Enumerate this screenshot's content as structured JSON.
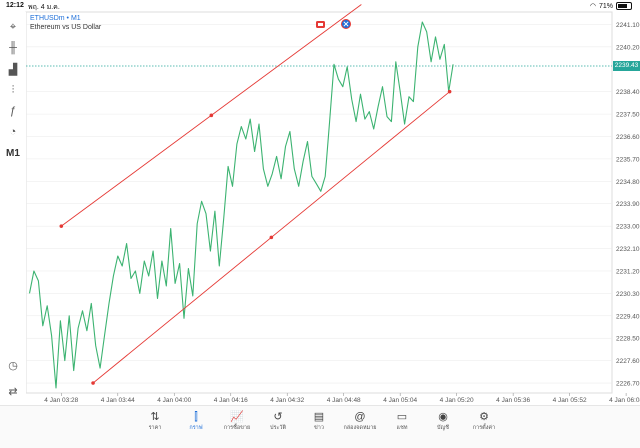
{
  "status": {
    "time": "12:12",
    "date": "พฤ. 4 ม.ค.",
    "battery": "71%",
    "battery_level": 0.71
  },
  "header": {
    "symbol_line": "ETHUSDm • M1",
    "description": "Ethereum vs US Dollar"
  },
  "toolbar": {
    "items": [
      {
        "name": "crosshair-icon",
        "glyph": "⌖"
      },
      {
        "name": "candlestick-icon",
        "glyph": "╫"
      },
      {
        "name": "indicators-icon",
        "glyph": "▟"
      },
      {
        "name": "settings-sliders-icon",
        "glyph": "⫶"
      },
      {
        "name": "function-icon",
        "glyph": "ƒ"
      },
      {
        "name": "shapes-icon",
        "glyph": "◔"
      }
    ],
    "timeframe": "M1",
    "bottom_icons": [
      {
        "name": "speedometer-icon",
        "glyph": "◷"
      },
      {
        "name": "trade-icon",
        "glyph": "⇄"
      }
    ]
  },
  "current_price": "2239.43",
  "chart_data": {
    "type": "line",
    "symbol": "ETHUSDm",
    "timeframe": "M1",
    "x_tick_labels": [
      "4 Jan 03:28",
      "4 Jan 03:44",
      "4 Jan 04:00",
      "4 Jan 04:16",
      "4 Jan 04:32",
      "4 Jan 04:48",
      "4 Jan 05:04",
      "4 Jan 05:20",
      "4 Jan 05:36",
      "4 Jan 05:52",
      "4 Jan 06:08"
    ],
    "y_tick_labels": [
      "2241.10",
      "2240.20",
      "2238.40",
      "2237.50",
      "2236.60",
      "2235.70",
      "2234.80",
      "2233.90",
      "2233.00",
      "2232.10",
      "2231.20",
      "2230.30",
      "2229.40",
      "2228.50",
      "2227.60",
      "2226.70"
    ],
    "ylim": [
      2226.3,
      2241.6
    ],
    "current_price": 2239.43,
    "series": [
      {
        "values": [
          2230.3,
          2231.2,
          2230.8,
          2229.0,
          2229.8,
          2228.6,
          2226.5,
          2229.2,
          2227.6,
          2229.4,
          2227.2,
          2228.9,
          2229.6,
          2228.8,
          2229.9,
          2228.2,
          2227.3,
          2228.6,
          2229.9,
          2231.0,
          2231.8,
          2231.4,
          2232.3,
          2230.9,
          2231.2,
          2230.3,
          2231.6,
          2231.0,
          2232.0,
          2230.1,
          2231.6,
          2230.6,
          2232.9,
          2230.7,
          2231.5,
          2229.3,
          2231.3,
          2230.2,
          2233.1,
          2234.0,
          2233.5,
          2232.0,
          2233.6,
          2231.4,
          2233.3,
          2235.4,
          2234.6,
          2236.3,
          2237.0,
          2236.5,
          2237.3,
          2236.0,
          2237.1,
          2235.3,
          2234.6,
          2235.1,
          2235.8,
          2234.9,
          2236.2,
          2236.8,
          2235.3,
          2234.6,
          2235.6,
          2236.4,
          2235.0,
          2234.7,
          2234.4,
          2235.0,
          2237.2,
          2239.5,
          2238.9,
          2238.6,
          2239.4,
          2238.1,
          2237.2,
          2238.3,
          2237.3,
          2237.6,
          2236.9,
          2237.8,
          2238.6,
          2237.4,
          2237.2,
          2239.6,
          2238.4,
          2237.1,
          2238.2,
          2238.0,
          2240.2,
          2241.2,
          2240.8,
          2239.6,
          2240.6,
          2239.7,
          2240.3,
          2238.4,
          2239.5
        ]
      }
    ],
    "trend_channel": {
      "upper": {
        "from": {
          "x": "4 Jan 03:28",
          "y": 2233.0
        },
        "to": {
          "x": "4 Jan 04:53",
          "y": 2241.9
        }
      },
      "lower": {
        "from": {
          "x": "4 Jan 03:37",
          "y": 2226.7
        },
        "to": {
          "x": "4 Jan 05:18",
          "y": 2238.4
        }
      },
      "midpoint_marker_upper": 2237.8,
      "midpoint_marker_lower": 2232.4
    },
    "colors": {
      "line": "#3cb371",
      "channel": "#e53935",
      "current_price": "#26a69a",
      "grid": "#e9e9e9"
    }
  },
  "bottom_nav": [
    {
      "name": "quotes",
      "label": "ราคา",
      "glyph": "⇅",
      "active": false
    },
    {
      "name": "chart",
      "label": "กราฟ",
      "glyph": "⫿",
      "active": true
    },
    {
      "name": "trade",
      "label": "การซื้อขาย",
      "glyph": "📈",
      "active": false
    },
    {
      "name": "history",
      "label": "ประวัติ",
      "glyph": "↺",
      "active": false
    },
    {
      "name": "news",
      "label": "ข่าว",
      "glyph": "▤",
      "active": false
    },
    {
      "name": "mailbox",
      "label": "กล่องจดหมาย",
      "glyph": "@",
      "active": false
    },
    {
      "name": "chat",
      "label": "แชท",
      "glyph": "▭",
      "active": false
    },
    {
      "name": "accounts",
      "label": "บัญชี",
      "glyph": "◉",
      "active": false
    },
    {
      "name": "settings",
      "label": "การตั้งค่า",
      "glyph": "⚙",
      "active": false
    }
  ]
}
